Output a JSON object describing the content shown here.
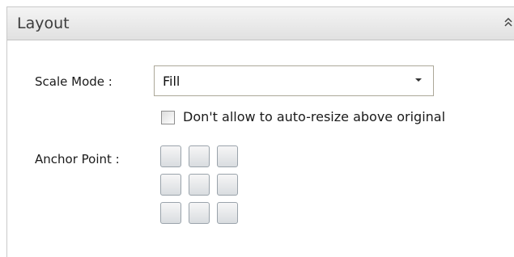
{
  "panel": {
    "title": "Layout",
    "collapse_icon": "double-chevron-up-icon"
  },
  "scale_mode": {
    "label": "Scale Mode :",
    "value": "Fill",
    "dropdown_icon": "dropdown-arrow-icon"
  },
  "auto_resize": {
    "label": "Don't allow to auto-resize above original",
    "checked": false
  },
  "anchor_point": {
    "label": "Anchor Point :",
    "cells": [
      "top-left",
      "top-center",
      "top-right",
      "middle-left",
      "center",
      "middle-right",
      "bottom-left",
      "bottom-center",
      "bottom-right"
    ]
  },
  "colors": {
    "header_bg": "#e8e8e8",
    "border": "#c9c9c9",
    "anchor_cell": "#dfe2e5"
  }
}
